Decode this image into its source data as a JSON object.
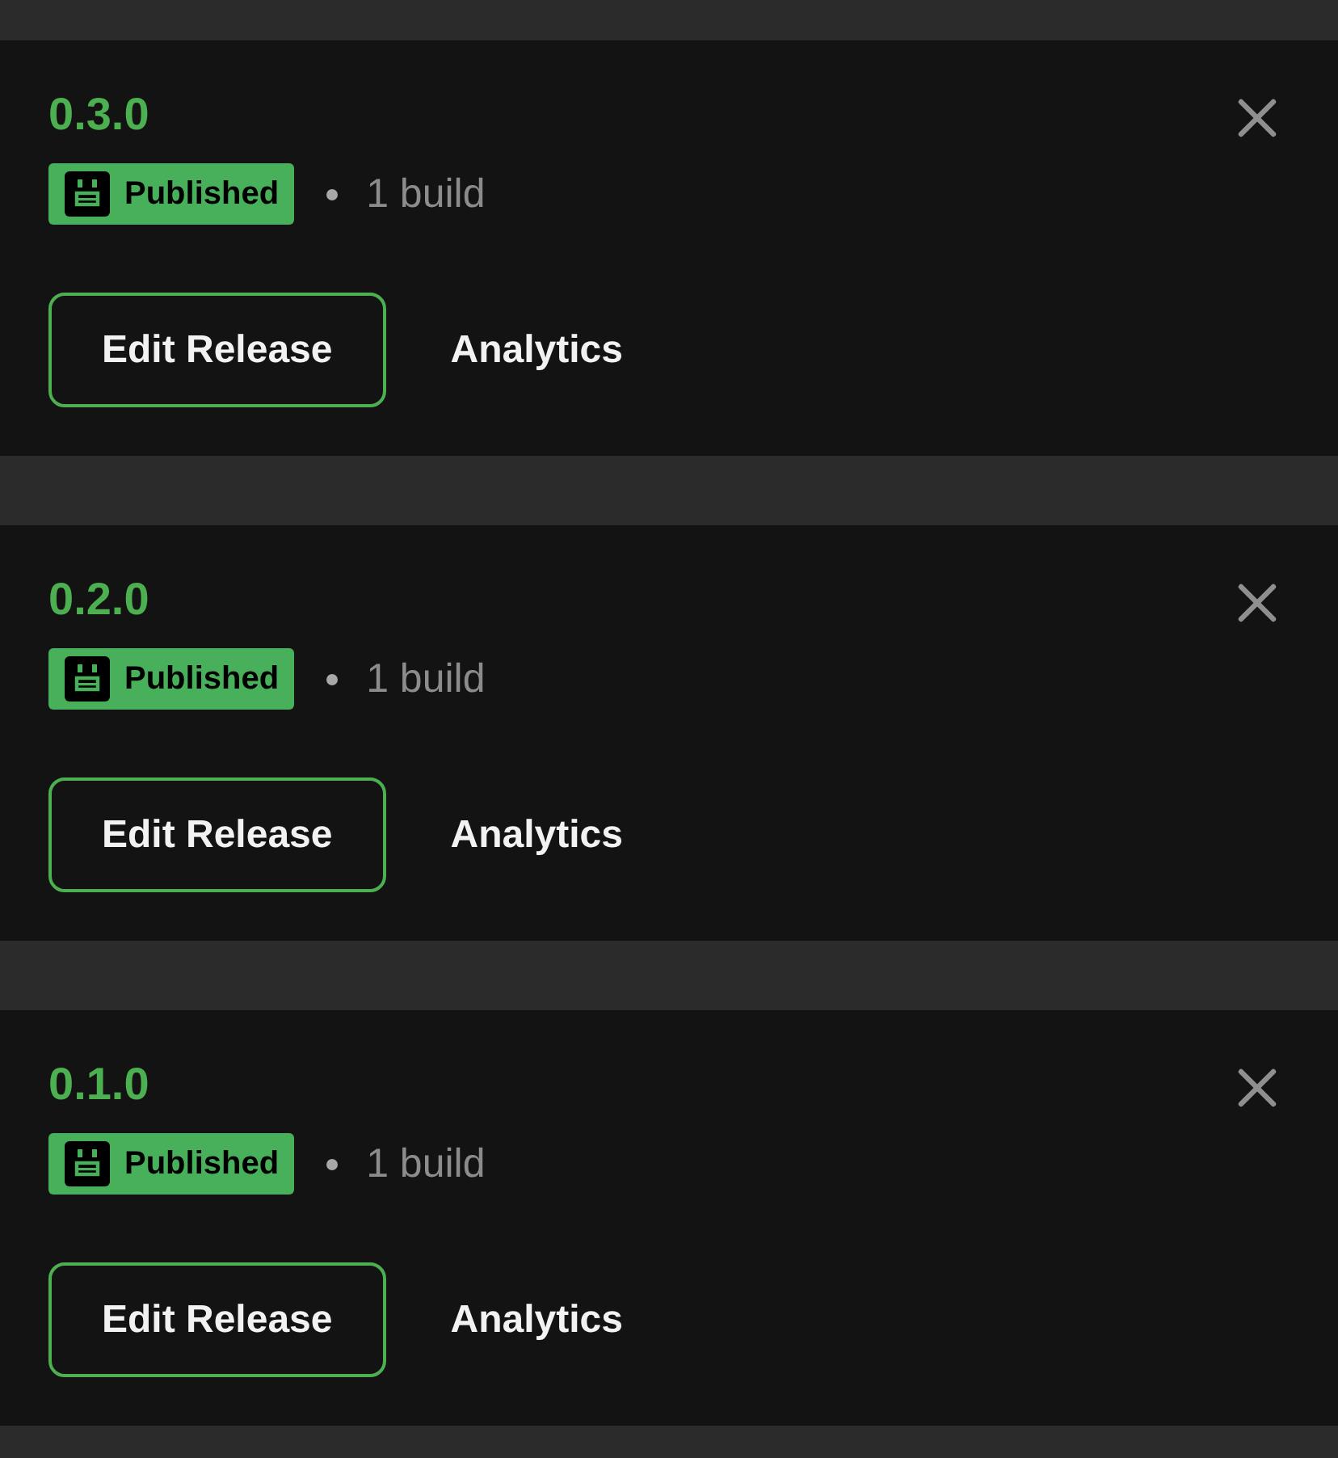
{
  "releases": [
    {
      "version": "0.3.0",
      "status": {
        "kind": "published",
        "label": "Published"
      },
      "builds": "1 build",
      "actions": [
        {
          "kind": "outlined",
          "label": "Edit Release"
        },
        {
          "kind": "text",
          "label": "Analytics"
        }
      ]
    },
    {
      "version": "0.2.0",
      "status": {
        "kind": "published",
        "label": "Published"
      },
      "builds": "1 build",
      "actions": [
        {
          "kind": "outlined",
          "label": "Edit Release"
        },
        {
          "kind": "text",
          "label": "Analytics"
        }
      ]
    },
    {
      "version": "0.1.0",
      "status": {
        "kind": "published",
        "label": "Published"
      },
      "builds": "1 build",
      "actions": [
        {
          "kind": "outlined",
          "label": "Edit Release"
        },
        {
          "kind": "text",
          "label": "Analytics"
        }
      ]
    }
  ]
}
